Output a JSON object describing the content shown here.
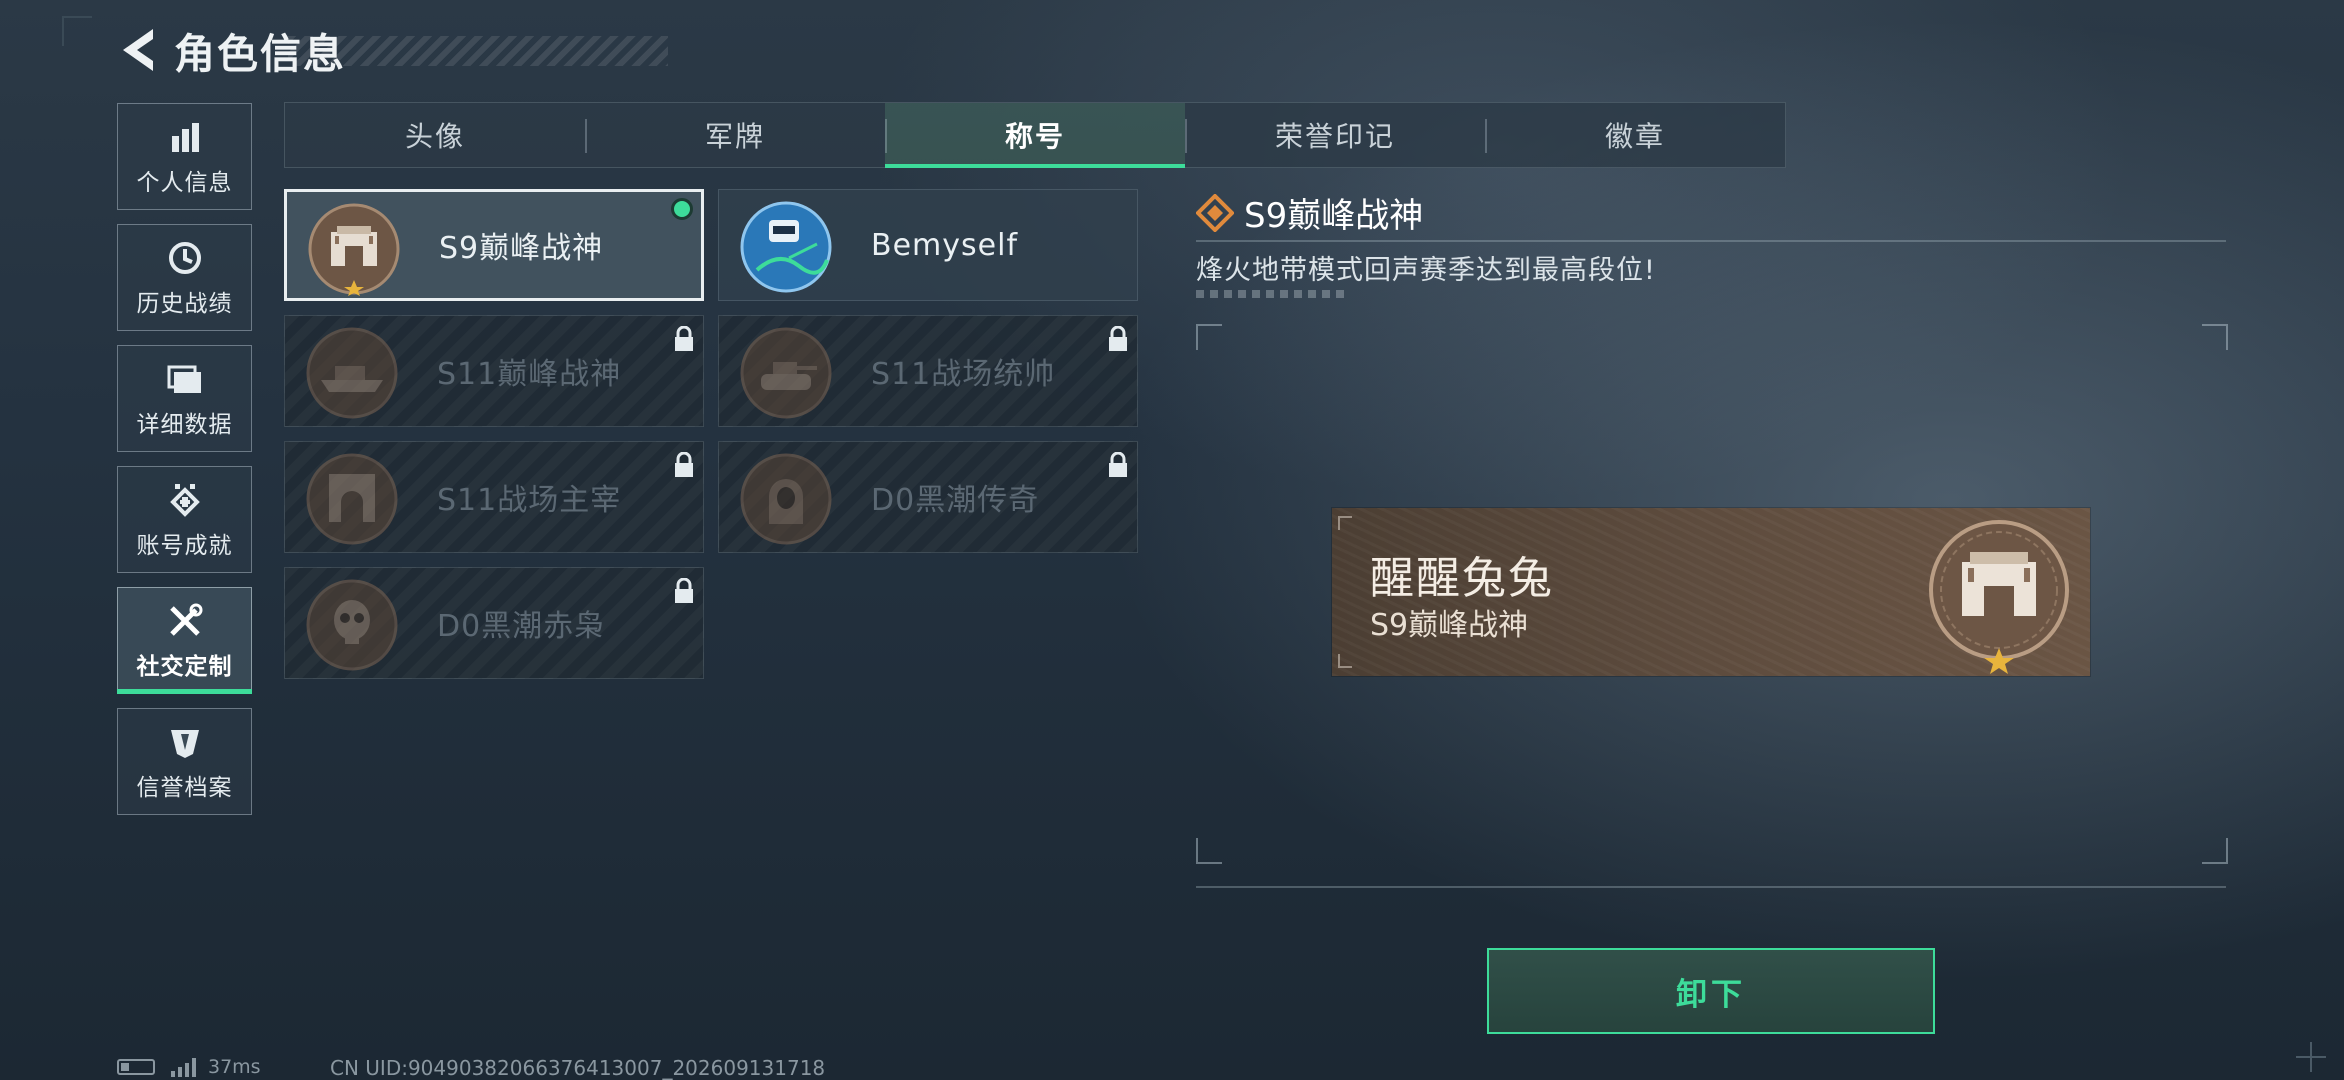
{
  "header": {
    "title": "角色信息",
    "back_icon": "back-arrow-icon"
  },
  "sidebar": {
    "items": [
      {
        "label": "个人信息",
        "icon": "bar-chart-icon"
      },
      {
        "label": "历史战绩",
        "icon": "clock-history-icon"
      },
      {
        "label": "详细数据",
        "icon": "folder-icon"
      },
      {
        "label": "账号成就",
        "icon": "achievement-icon"
      },
      {
        "label": "社交定制",
        "icon": "tools-icon",
        "active": true
      },
      {
        "label": "信誉档案",
        "icon": "credit-shield-icon"
      }
    ]
  },
  "tabs": [
    {
      "label": "头像"
    },
    {
      "label": "军牌"
    },
    {
      "label": "称号",
      "active": true
    },
    {
      "label": "荣誉印记"
    },
    {
      "label": "徽章"
    }
  ],
  "titles": [
    {
      "name": "S9巅峰战神",
      "locked": false,
      "selected": true,
      "equipped": true,
      "emblem": "fortress-gate-emblem"
    },
    {
      "name": "Bemyself",
      "locked": false,
      "selected": false,
      "emblem": "graffiti-emblem"
    },
    {
      "name": "S11巅峰战神",
      "locked": true,
      "emblem": "hovercraft-emblem"
    },
    {
      "name": "S11战场统帅",
      "locked": true,
      "emblem": "tank-emblem"
    },
    {
      "name": "S11战场主宰",
      "locked": true,
      "emblem": "arch-gate-emblem"
    },
    {
      "name": "D0黑潮传奇",
      "locked": true,
      "emblem": "hooded-soldier-emblem"
    },
    {
      "name": "D0黑潮赤枭",
      "locked": true,
      "emblem": "skull-emblem"
    }
  ],
  "detail": {
    "title": "S9巅峰战神",
    "description": "烽火地带模式回声赛季达到最高段位!",
    "title_icon": "diamond-rank-icon"
  },
  "preview": {
    "player_name": "醒醒兔兔",
    "title": "S9巅峰战神"
  },
  "actions": {
    "unequip_label": "卸下"
  },
  "status": {
    "ping": "37ms",
    "uid": "CN UID:90490382066376413007_202609131718"
  },
  "colors": {
    "accent": "#3ddc9a",
    "locked_text": "#5b6873",
    "plate": "#5e4c3e"
  }
}
